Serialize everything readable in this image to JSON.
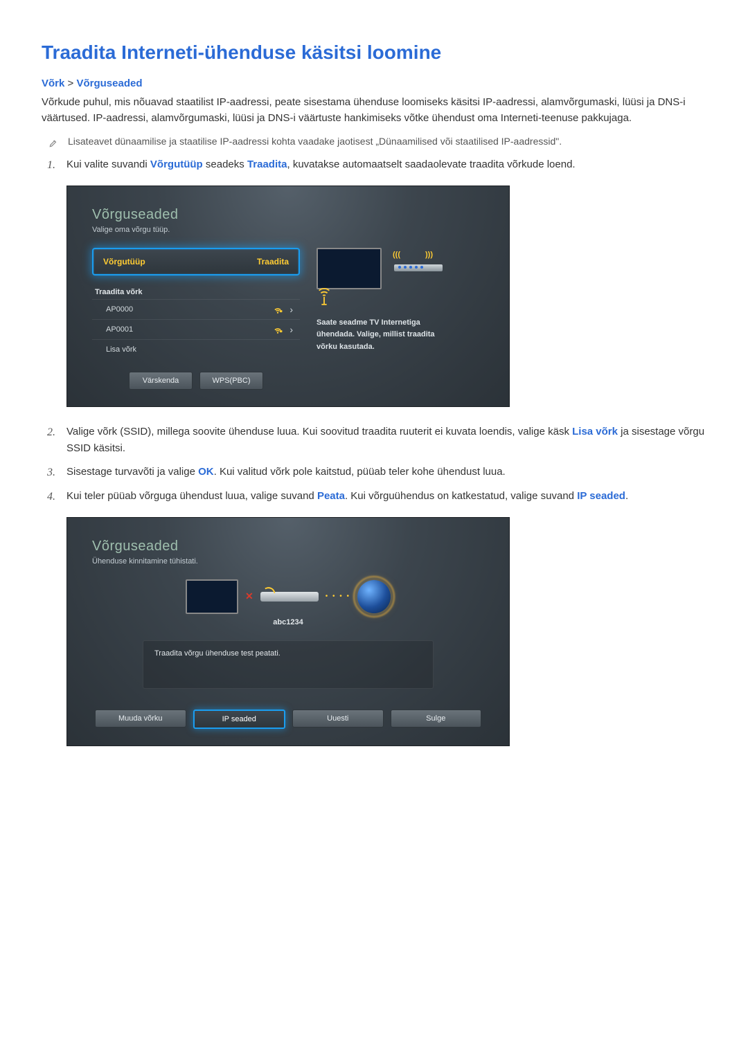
{
  "title": "Traadita Interneti-ühenduse käsitsi loomine",
  "breadcrumb": {
    "a": "Võrk",
    "sep": ">",
    "b": "Võrguseaded"
  },
  "intro": "Võrkude puhul, mis nõuavad staatilist IP-aadressi, peate sisestama ühenduse loomiseks käsitsi IP-aadressi, alamvõrgumaski, lüüsi ja DNS-i väärtused. IP-aadressi, alamvõrgumaski, lüüsi ja DNS-i väärtuste hankimiseks võtke ühendust oma Interneti-teenuse pakkujaga.",
  "note": "Lisateavet dünaamilise ja staatilise IP-aadressi kohta vaadake jaotisest „Dünaamilised või staatilised IP-aadressid\".",
  "steps": {
    "s1a": "Kui valite suvandi ",
    "s1k1": "Võrgutüüp",
    "s1b": " seadeks ",
    "s1k2": "Traadita",
    "s1c": ", kuvatakse automaatselt saadaolevate traadita võrkude loend.",
    "s2a": "Valige võrk (SSID), millega soovite ühenduse luua. Kui soovitud traadita ruuterit ei kuvata loendis, valige käsk ",
    "s2k1": "Lisa võrk",
    "s2b": " ja sisestage võrgu SSID käsitsi.",
    "s3a": "Sisestage turvavõti ja valige ",
    "s3k1": "OK",
    "s3b": ". Kui valitud võrk pole kaitstud, püüab teler kohe ühendust luua.",
    "s4a": "Kui teler püüab võrguga ühendust luua, valige suvand ",
    "s4k1": "Peata",
    "s4b": ". Kui võrguühendus on katkestatud, valige suvand ",
    "s4k2": "IP seaded",
    "s4c": "."
  },
  "nums": {
    "n1": "1.",
    "n2": "2.",
    "n3": "3.",
    "n4": "4."
  },
  "panel1": {
    "title": "Võrguseaded",
    "sub": "Valige oma võrgu tüüp.",
    "row_label": "Võrgutüüp",
    "row_value": "Traadita",
    "section": "Traadita võrk",
    "aps": [
      "AP0000",
      "AP0001"
    ],
    "add": "Lisa võrk",
    "btn_refresh": "Värskenda",
    "btn_wps": "WPS(PBC)",
    "right_text": "Saate seadme TV Internetiga ühendada. Valige, millist traadita võrku kasutada.",
    "wave_left": "(((",
    "wave_right": ")))"
  },
  "panel2": {
    "title": "Võrguseaded",
    "sub": "Ühenduse kinnitamine tühistati.",
    "abc": "abc1234",
    "msg": "Traadita võrgu ühenduse test peatati.",
    "btn_change": "Muuda võrku",
    "btn_ip": "IP seaded",
    "btn_retry": "Uuesti",
    "btn_close": "Sulge"
  }
}
